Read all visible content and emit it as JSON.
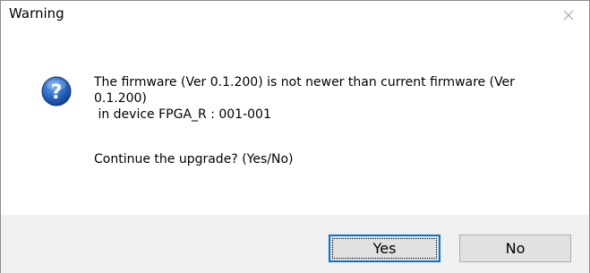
{
  "window": {
    "title": "Warning",
    "close_icon": "close-icon"
  },
  "message": {
    "icon": "question-icon",
    "lines": [
      "The firmware (Ver 0.1.200) is not newer than current firmware (Ver",
      "0.1.200)",
      " in device FPGA_R : 001-001"
    ],
    "question": "Continue the upgrade? (Yes/No)"
  },
  "buttons": {
    "yes_label": "Yes",
    "no_label": "No"
  },
  "colors": {
    "footer_bg": "#f0f0f0",
    "button_bg": "#e1e1e1",
    "focus_border": "#0078d7",
    "icon_blue": "#1d5bb8"
  }
}
